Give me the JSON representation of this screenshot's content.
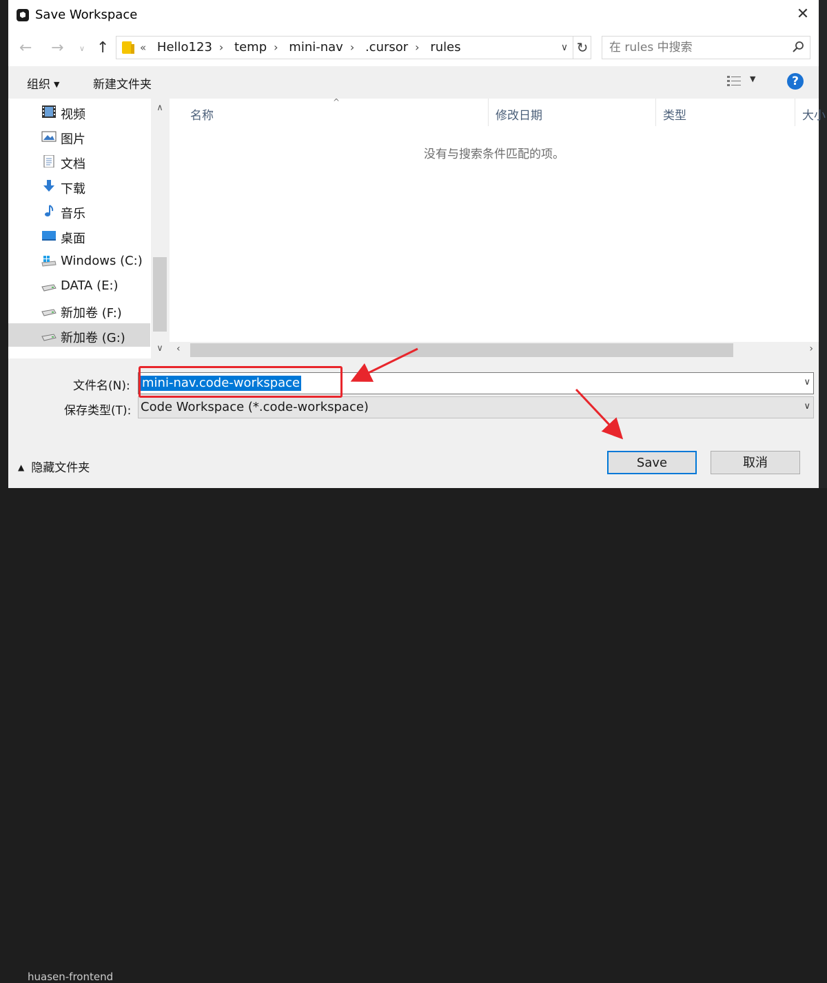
{
  "window": {
    "title": "Save Workspace"
  },
  "address_bar": {
    "overflow": "«",
    "breadcrumbs": [
      "Hello123",
      "temp",
      "mini-nav",
      ".cursor",
      "rules"
    ]
  },
  "search": {
    "placeholder": "在 rules 中搜索"
  },
  "toolbar": {
    "organize": "组织",
    "new_folder": "新建文件夹"
  },
  "sidebar": {
    "items": [
      {
        "label": "视频",
        "icon": "video-icon"
      },
      {
        "label": "图片",
        "icon": "pictures-icon"
      },
      {
        "label": "文档",
        "icon": "documents-icon"
      },
      {
        "label": "下载",
        "icon": "download-icon"
      },
      {
        "label": "音乐",
        "icon": "music-icon"
      },
      {
        "label": "桌面",
        "icon": "desktop-icon"
      },
      {
        "label": "Windows (C:)",
        "icon": "windows-drive-icon"
      },
      {
        "label": "DATA (E:)",
        "icon": "drive-icon"
      },
      {
        "label": "新加卷 (F:)",
        "icon": "drive-icon"
      },
      {
        "label": "新加卷 (G:)",
        "icon": "drive-icon",
        "selected": true
      }
    ]
  },
  "file_list": {
    "columns": [
      "名称",
      "修改日期",
      "类型",
      "大小"
    ],
    "empty_message": "没有与搜索条件匹配的项。"
  },
  "form": {
    "filename_label": "文件名(N):",
    "filename_value": "mini-nav.code-workspace",
    "filetype_label": "保存类型(T):",
    "filetype_value": "Code Workspace (*.code-workspace)"
  },
  "footer": {
    "hide_folders": "隐藏文件夹",
    "save": "Save",
    "cancel": "取消"
  },
  "background": {
    "bottom_text": "huasen-frontend"
  },
  "colors": {
    "accent": "#0078d7",
    "highlight": "#e8262c",
    "help": "#1a72d3"
  }
}
